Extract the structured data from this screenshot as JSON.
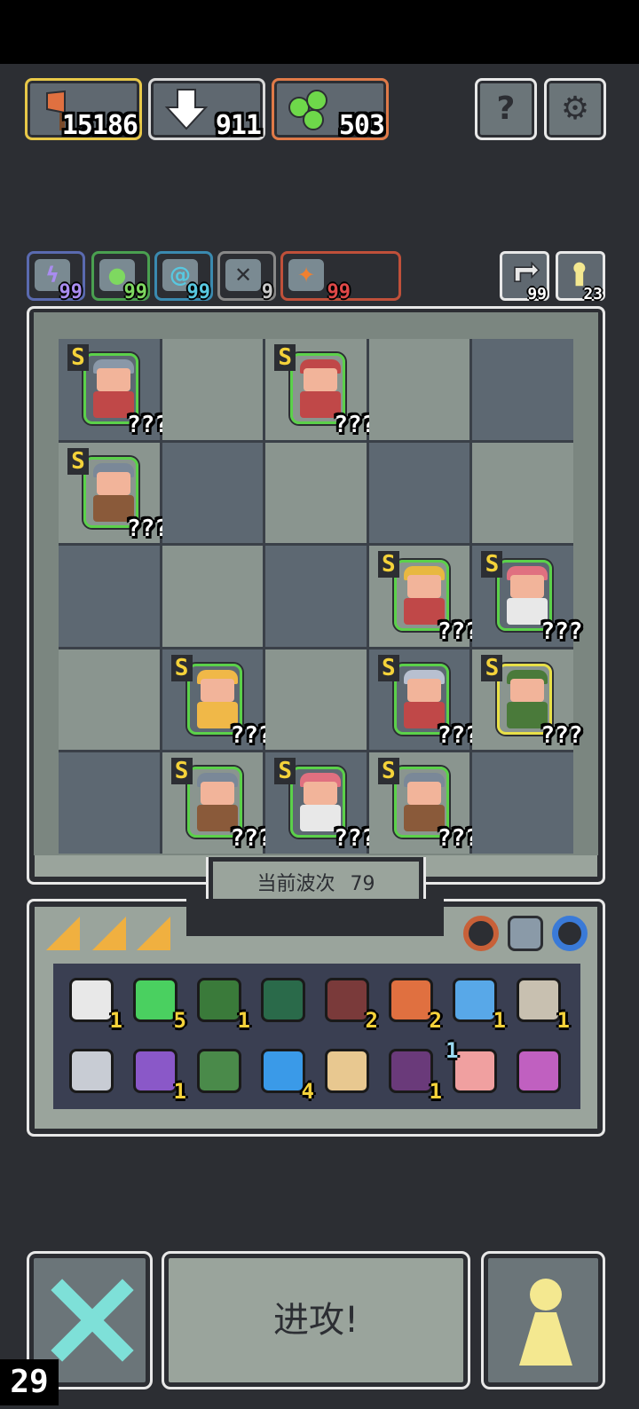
{
  "resources": [
    {
      "name": "axe",
      "value": "15186",
      "color": "#e8c848"
    },
    {
      "name": "arrow",
      "value": "911",
      "color": "#d8d8d8"
    },
    {
      "name": "grape",
      "value": "503",
      "color": "#e07a48"
    }
  ],
  "top_buttons": {
    "help": "?",
    "settings": "⚙"
  },
  "buffs": [
    {
      "icon": "lightning-icon",
      "value": "99",
      "color": "#a98cf0"
    },
    {
      "icon": "grape-icon",
      "value": "99",
      "color": "#7ed860"
    },
    {
      "icon": "spiral-icon",
      "value": "99",
      "color": "#58c8e0"
    },
    {
      "icon": "bird-icon",
      "value": "9",
      "color": "#c8c8c8"
    },
    {
      "icon": "fire-icon",
      "value": "99",
      "color": "#e04848"
    }
  ],
  "side_counters": {
    "refresh": "99",
    "keyhole": "23"
  },
  "board": {
    "rank_letter": "S",
    "level_unknown": "???"
  },
  "wave": {
    "label": "当前波次",
    "number": "79"
  },
  "inventory": {
    "row1": [
      {
        "icon": "scroll-icon",
        "count": "1"
      },
      {
        "icon": "emerald-icon",
        "count": "5"
      },
      {
        "icon": "hood-icon",
        "count": "1"
      },
      {
        "icon": "map-icon",
        "count": ""
      },
      {
        "icon": "stump-icon",
        "count": "2"
      },
      {
        "icon": "axe-icon",
        "count": "2"
      },
      {
        "icon": "crossbow-icon",
        "count": "1"
      },
      {
        "icon": "parchment-icon",
        "count": "1"
      }
    ],
    "row2": [
      {
        "icon": "mirror-icon",
        "count": ""
      },
      {
        "icon": "potion-icon",
        "count": "1"
      },
      {
        "icon": "green-arrow-icon",
        "count": ""
      },
      {
        "icon": "orb-icon",
        "count": "4"
      },
      {
        "icon": "crown-icon",
        "count": ""
      },
      {
        "icon": "demon-icon",
        "count": "1"
      },
      {
        "icon": "hand-icon",
        "count": "1"
      },
      {
        "icon": "purple-arrow-icon",
        "count": ""
      }
    ]
  },
  "attack_label": "进攻!",
  "fps": "29"
}
